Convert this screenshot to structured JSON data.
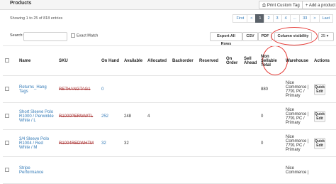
{
  "header": {
    "title": "Products",
    "print_tag": "Print Custom Tag",
    "add_product": "+ Add a product"
  },
  "entries_text": "Showing 1 to 25 of 818 entries",
  "pagination": [
    "First",
    "<",
    "1",
    "2",
    "3",
    "4",
    "...",
    "33",
    ">",
    "Last"
  ],
  "search": {
    "label": "Search:",
    "placeholder": ""
  },
  "exact_match": "Exact Match",
  "toolbar": {
    "export": "Export All Rows",
    "csv": "CSV",
    "pdf": "PDF",
    "column_visibility": "Column visibility",
    "page_length": "25"
  },
  "columns": [
    "",
    "Name",
    "SKU",
    "On Hand",
    "Available",
    "Allocated",
    "Backorder",
    "Reserved",
    "On Order",
    "Sell Ahead",
    "Non Sellable Total",
    "Warehouse",
    "Actions"
  ],
  "rows": [
    {
      "name": "Returns_Hang Tags",
      "sku": "RETHANGTAG1",
      "on_hand": "0",
      "available": "",
      "allocated": "",
      "backorder": "",
      "reserved": "",
      "on_order": "",
      "sell_ahead": "",
      "non_sellable": "880",
      "warehouse": "Nice Commerce | 7791 PC / Primary",
      "action": "Quick Edit"
    },
    {
      "name": "Short Sleeve Polo R1000 / Perwinkle White / L",
      "sku": "R1000PERWWTL",
      "on_hand": "252",
      "available": "248",
      "allocated": "4",
      "backorder": "",
      "reserved": "",
      "on_order": "",
      "sell_ahead": "",
      "non_sellable": "0",
      "warehouse": "Nice Commerce | 7791 PC / Primary",
      "action": "Quick Edit"
    },
    {
      "name": "3/4 Sleeve Polo R1004 / Red White / M",
      "sku": "R1004REDWHTM",
      "on_hand": "32",
      "available": "32",
      "allocated": "",
      "backorder": "",
      "reserved": "",
      "on_order": "",
      "sell_ahead": "",
      "non_sellable": "0",
      "warehouse": "Nice Commerce | 7791 PC / Primary",
      "action": "Quick Edit"
    },
    {
      "name": "Stripe Performance",
      "sku": "",
      "on_hand": "",
      "available": "",
      "allocated": "",
      "backorder": "",
      "reserved": "",
      "on_order": "",
      "sell_ahead": "",
      "non_sellable": "",
      "warehouse": "Nice Commerce |",
      "action": ""
    }
  ]
}
